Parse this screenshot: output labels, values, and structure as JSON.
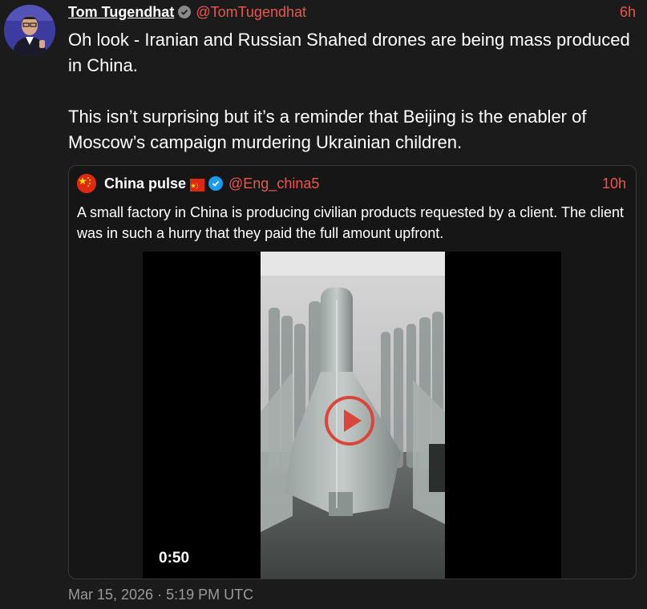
{
  "tweet": {
    "author_name": "Tom Tugendhat",
    "handle": "@TomTugendhat",
    "time": "6h",
    "paragraphs": [
      "Oh look - Iranian and Russian Shahed drones are being mass produced in China.",
      "This isn’t surprising but it’s a reminder that Beijing is the enabler of Moscow’s campaign murdering Ukrainian children."
    ],
    "timestamp": "Mar 15, 2026 · 5:19 PM UTC"
  },
  "quote": {
    "author_name": "China pulse",
    "handle": "@Eng_china5",
    "time": "10h",
    "text": "A small factory in China is producing civilian products requested by a client. The client was in such a hurry that they paid the full amount upfront.",
    "video": {
      "duration": "0:50"
    }
  },
  "colors": {
    "background": "#1b1b1b",
    "accent": "#e8584d",
    "verified_blue": "#1d9bf0"
  },
  "icons": {
    "verified": "gray-verified-check-icon",
    "quote_verified": "blue-verified-check-icon",
    "flag": "china-flag-icon",
    "play": "play-icon"
  }
}
